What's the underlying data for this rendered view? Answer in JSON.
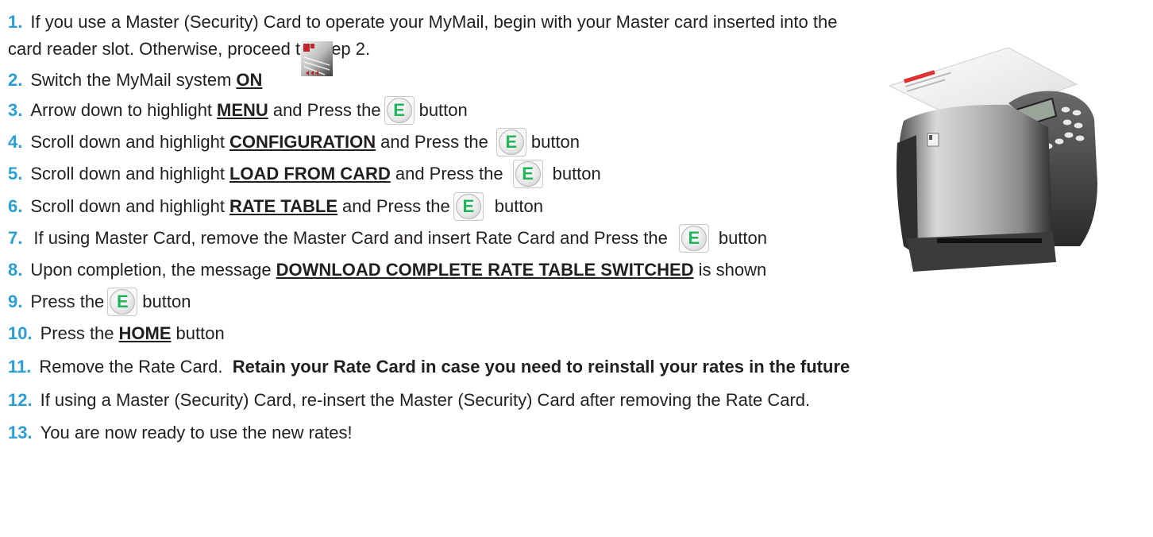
{
  "steps": [
    {
      "num": "1.",
      "parts": [
        "If you use a Master (Security) Card to operate your MyMail, begin with your Master card inserted into the",
        "card reader slot.  Otherwise, proceed to Step 2."
      ]
    },
    {
      "num": "2.",
      "pre": "Switch the MyMail system ",
      "kw": "ON"
    },
    {
      "num": "3.",
      "pre": "Arrow down to highlight ",
      "kw": "MENU",
      "post": " and Press the",
      "btn": "E",
      "tail": "button"
    },
    {
      "num": "4.",
      "pre": "Scroll down and highlight ",
      "kw": "CONFIGURATION",
      "post": " and Press the",
      "btn": "E",
      "tail": "button"
    },
    {
      "num": "5.",
      "pre": "Scroll down and highlight ",
      "kw": "LOAD FROM CARD",
      "post": " and Press the",
      "btn": "E",
      "tail": "button"
    },
    {
      "num": "6.",
      "pre": "Scroll down and highlight ",
      "kw": "RATE TABLE",
      "post": " and Press the",
      "btn": "E",
      "tail": "button"
    },
    {
      "num": "7.",
      "pre": "If using Master Card, remove the Master Card and insert Rate Card and Press the",
      "btn": "E",
      "tail": "button"
    },
    {
      "num": "8.",
      "pre": "Upon completion, the message ",
      "kw": "DOWNLOAD COMPLETE RATE TABLE SWITCHED",
      "post": " is shown"
    },
    {
      "num": "9.",
      "pre": "Press the",
      "btn": "E",
      "tail": "button"
    },
    {
      "num": "10.",
      "pre": "Press the ",
      "kw": "HOME",
      "post": " button"
    },
    {
      "num": "11.",
      "pre": "Remove the Rate Card.  ",
      "strong": "Retain your Rate Card in case you need to reinstall your rates in the future"
    },
    {
      "num": "12.",
      "pre": "If using a Master (Security) Card, re-insert the Master (Security) Card after removing the Rate Card."
    },
    {
      "num": "13.",
      "pre": "You are now ready to use the new rates!"
    }
  ],
  "colors": {
    "step_number": "#2a9fd6",
    "button_letter": "#1fb55a",
    "text": "#231f20"
  },
  "icons": {
    "card": "master-card-image",
    "machine": "franking-machine-image",
    "button": "e-button-icon"
  }
}
